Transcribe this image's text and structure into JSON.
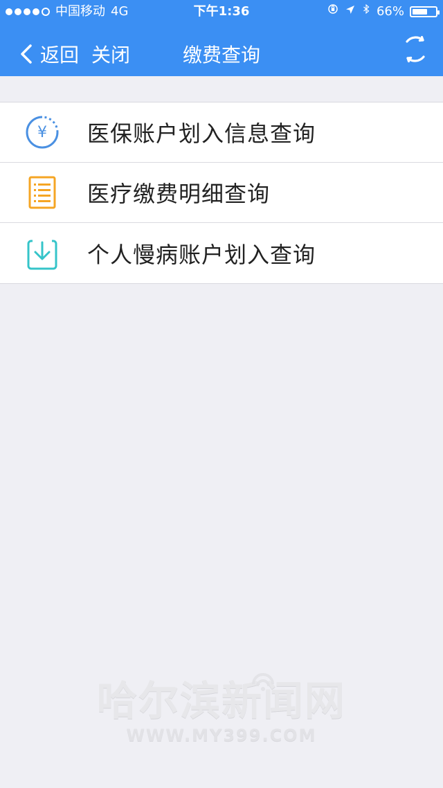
{
  "status_bar": {
    "carrier": "中国移动",
    "network": "4G",
    "time": "下午1:36",
    "battery_percent_text": "66%",
    "battery_level": 66
  },
  "nav": {
    "back_label": "返回",
    "close_label": "关闭",
    "title": "缴费查询"
  },
  "list": {
    "items": [
      {
        "label": "医保账户划入信息查询",
        "icon": "yuan-circle-icon"
      },
      {
        "label": "医疗缴费明细查询",
        "icon": "document-list-icon"
      },
      {
        "label": "个人慢病账户划入查询",
        "icon": "download-tray-icon"
      }
    ]
  },
  "watermark": {
    "text_cn": "哈尔滨新闻网",
    "text_en": "WWW.MY399.COM"
  },
  "colors": {
    "header_bg": "#3b8ff3",
    "page_bg": "#efeff4",
    "icon_blue": "#4a90e2",
    "icon_orange": "#f5a524",
    "icon_teal": "#35c4c9"
  }
}
